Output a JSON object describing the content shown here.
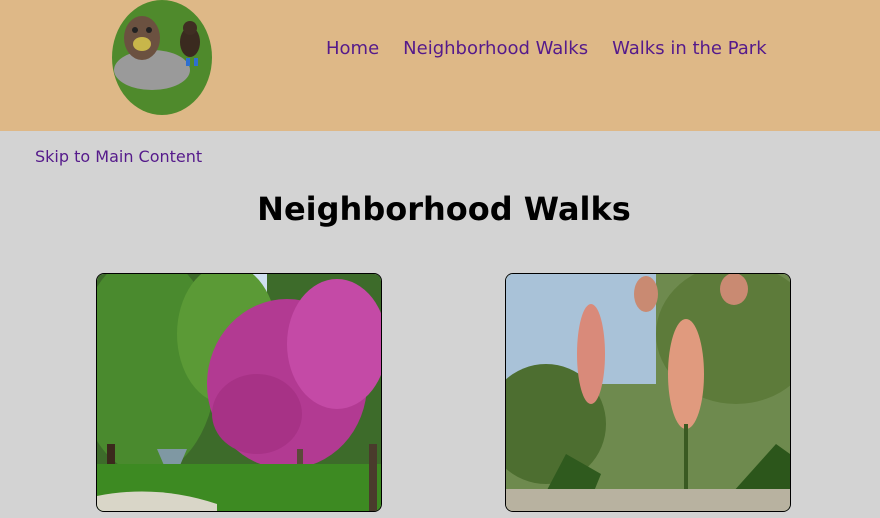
{
  "header": {
    "logo_icon": "two-dogs-photo-icon",
    "nav": [
      {
        "label": "Home"
      },
      {
        "label": "Neighborhood Walks"
      },
      {
        "label": "Walks in the Park"
      }
    ]
  },
  "skip_link": "Skip to Main Content",
  "main": {
    "title": "Neighborhood Walks",
    "photos": [
      {
        "icon": "flowering-tree-photo-icon"
      },
      {
        "icon": "blossom-branch-photo-icon"
      }
    ]
  },
  "colors": {
    "header_bg": "#deb887",
    "page_bg": "#d3d3d3",
    "link": "#551a8b"
  }
}
